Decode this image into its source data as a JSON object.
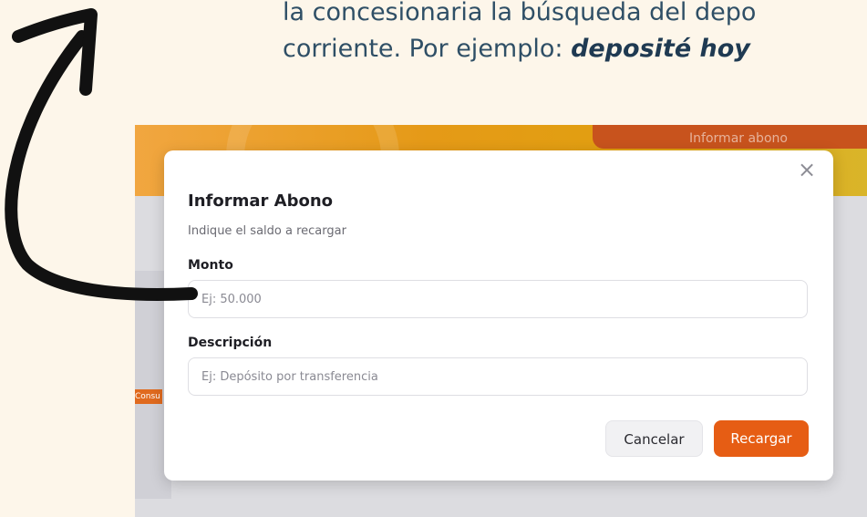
{
  "instruction": {
    "line1": "la concesionaria la búsqueda del depo",
    "line2_prefix": "corriente. Por ejemplo: ",
    "line2_emphasis": "deposité hoy "
  },
  "background_app": {
    "top_button_label": "Informar abono",
    "side_tag_label": "Consu"
  },
  "modal": {
    "title": "Informar Abono",
    "subtitle": "Indique el saldo a recargar",
    "close_icon": "close-icon",
    "fields": [
      {
        "label": "Monto",
        "value": "",
        "placeholder": "Ej: 50.000"
      },
      {
        "label": "Descripción",
        "value": "",
        "placeholder": "Ej: Depósito por transferencia"
      }
    ],
    "cancel_label": "Cancelar",
    "submit_label": "Recargar"
  },
  "colors": {
    "accent": "#e65d14",
    "banner": "#e59a17",
    "arrow": "#111111"
  }
}
